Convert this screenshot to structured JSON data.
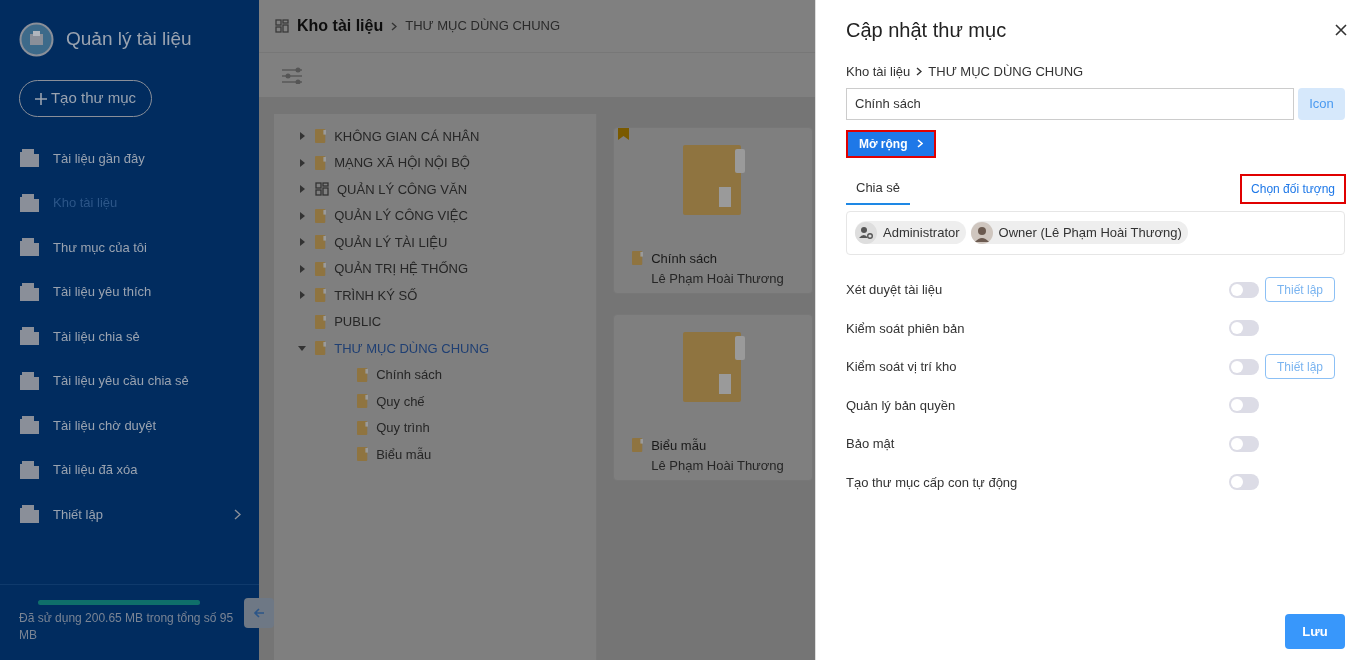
{
  "sidebar": {
    "app_title": "Quản lý tài liệu",
    "create_button": "Tạo thư mục",
    "items": [
      {
        "label": "Tài liệu gần đây",
        "selected": false,
        "expandable": false
      },
      {
        "label": "Kho tài liệu",
        "selected": true,
        "expandable": false
      },
      {
        "label": "Thư mục của tôi",
        "selected": false,
        "expandable": false
      },
      {
        "label": "Tài liệu yêu thích",
        "selected": false,
        "expandable": false
      },
      {
        "label": "Tài liệu chia sẻ",
        "selected": false,
        "expandable": false
      },
      {
        "label": "Tài liệu yêu cầu chia sẻ",
        "selected": false,
        "expandable": false
      },
      {
        "label": "Tài liệu chờ duyệt",
        "selected": false,
        "expandable": false
      },
      {
        "label": "Tài liệu đã xóa",
        "selected": false,
        "expandable": false
      },
      {
        "label": "Thiết lập",
        "selected": false,
        "expandable": true
      }
    ],
    "storage": {
      "text": "Đã sử dụng 200.65 MB trong tổng số 95 MB",
      "level": 1
    }
  },
  "main": {
    "breadcrumb": {
      "root": "Kho tài liệu",
      "current": "THƯ MỤC DÙNG CHUNG"
    },
    "tree": [
      {
        "label": "KHÔNG GIAN CÁ NHÂN",
        "kind": "folder",
        "expanded": false,
        "selected": false
      },
      {
        "label": "MẠNG XÃ HỘI NỘI BỘ",
        "kind": "folder",
        "expanded": false,
        "selected": false
      },
      {
        "label": "QUẢN LÝ CÔNG VĂN",
        "kind": "grid",
        "expanded": false,
        "selected": false
      },
      {
        "label": "QUẢN LÝ CÔNG VIỆC",
        "kind": "folder",
        "expanded": false,
        "selected": false
      },
      {
        "label": "QUẢN LÝ TÀI LIỆU",
        "kind": "folder",
        "expanded": false,
        "selected": false
      },
      {
        "label": "QUẢN TRỊ HỆ THỐNG",
        "kind": "folder",
        "expanded": false,
        "selected": false
      },
      {
        "label": "TRÌNH KÝ SỐ",
        "kind": "folder",
        "expanded": false,
        "selected": false
      },
      {
        "label": "PUBLIC",
        "kind": "folder",
        "selected": false
      },
      {
        "label": "THƯ MỤC DÙNG CHUNG",
        "kind": "folder",
        "expanded": true,
        "selected": true,
        "children": [
          {
            "label": "Chính sách",
            "kind": "folder",
            "selected": false
          },
          {
            "label": "Quy chế",
            "kind": "folder",
            "selected": false
          },
          {
            "label": "Quy trình",
            "kind": "folder",
            "selected": false
          },
          {
            "label": "Biểu mẫu",
            "kind": "folder",
            "selected": false
          }
        ]
      }
    ],
    "cards": [
      {
        "title": "Chính sách",
        "owner": "Lê Phạm Hoài Thương",
        "bookmarked": true
      },
      {
        "title": "Biểu mẫu",
        "owner": "Lê Phạm Hoài Thương",
        "bookmarked": false
      }
    ]
  },
  "drawer": {
    "title": "Cập nhật thư mục",
    "breadcrumb": {
      "root": "Kho tài liệu",
      "current": "THƯ MỤC DÙNG CHUNG"
    },
    "name_field": {
      "value": "Chính sách"
    },
    "icon_button": "Icon",
    "expand_button": {
      "label": "Mở rộng",
      "highlighted": true
    },
    "tabs": [
      {
        "label": "Chia sẻ",
        "selected": true
      }
    ],
    "choose_link": {
      "label": "Chọn đối tượng",
      "highlighted": true
    },
    "share_chips": [
      {
        "label": "Administrator",
        "kind": "role"
      },
      {
        "label": "Owner (Lê Phạm Hoài Thương)",
        "kind": "user"
      }
    ],
    "settings": [
      {
        "label": "Xét duyệt tài liệu",
        "on": false,
        "setup_button": "Thiết lập"
      },
      {
        "label": "Kiểm soát phiên bản",
        "on": false
      },
      {
        "label": "Kiểm soát vị trí kho",
        "on": false,
        "setup_button": "Thiết lập"
      },
      {
        "label": "Quản lý bản quyền",
        "on": false
      },
      {
        "label": "Bảo mật",
        "on": false
      },
      {
        "label": "Tạo thư mục cấp con tự động",
        "on": false
      }
    ],
    "save_button": "Lưu"
  }
}
